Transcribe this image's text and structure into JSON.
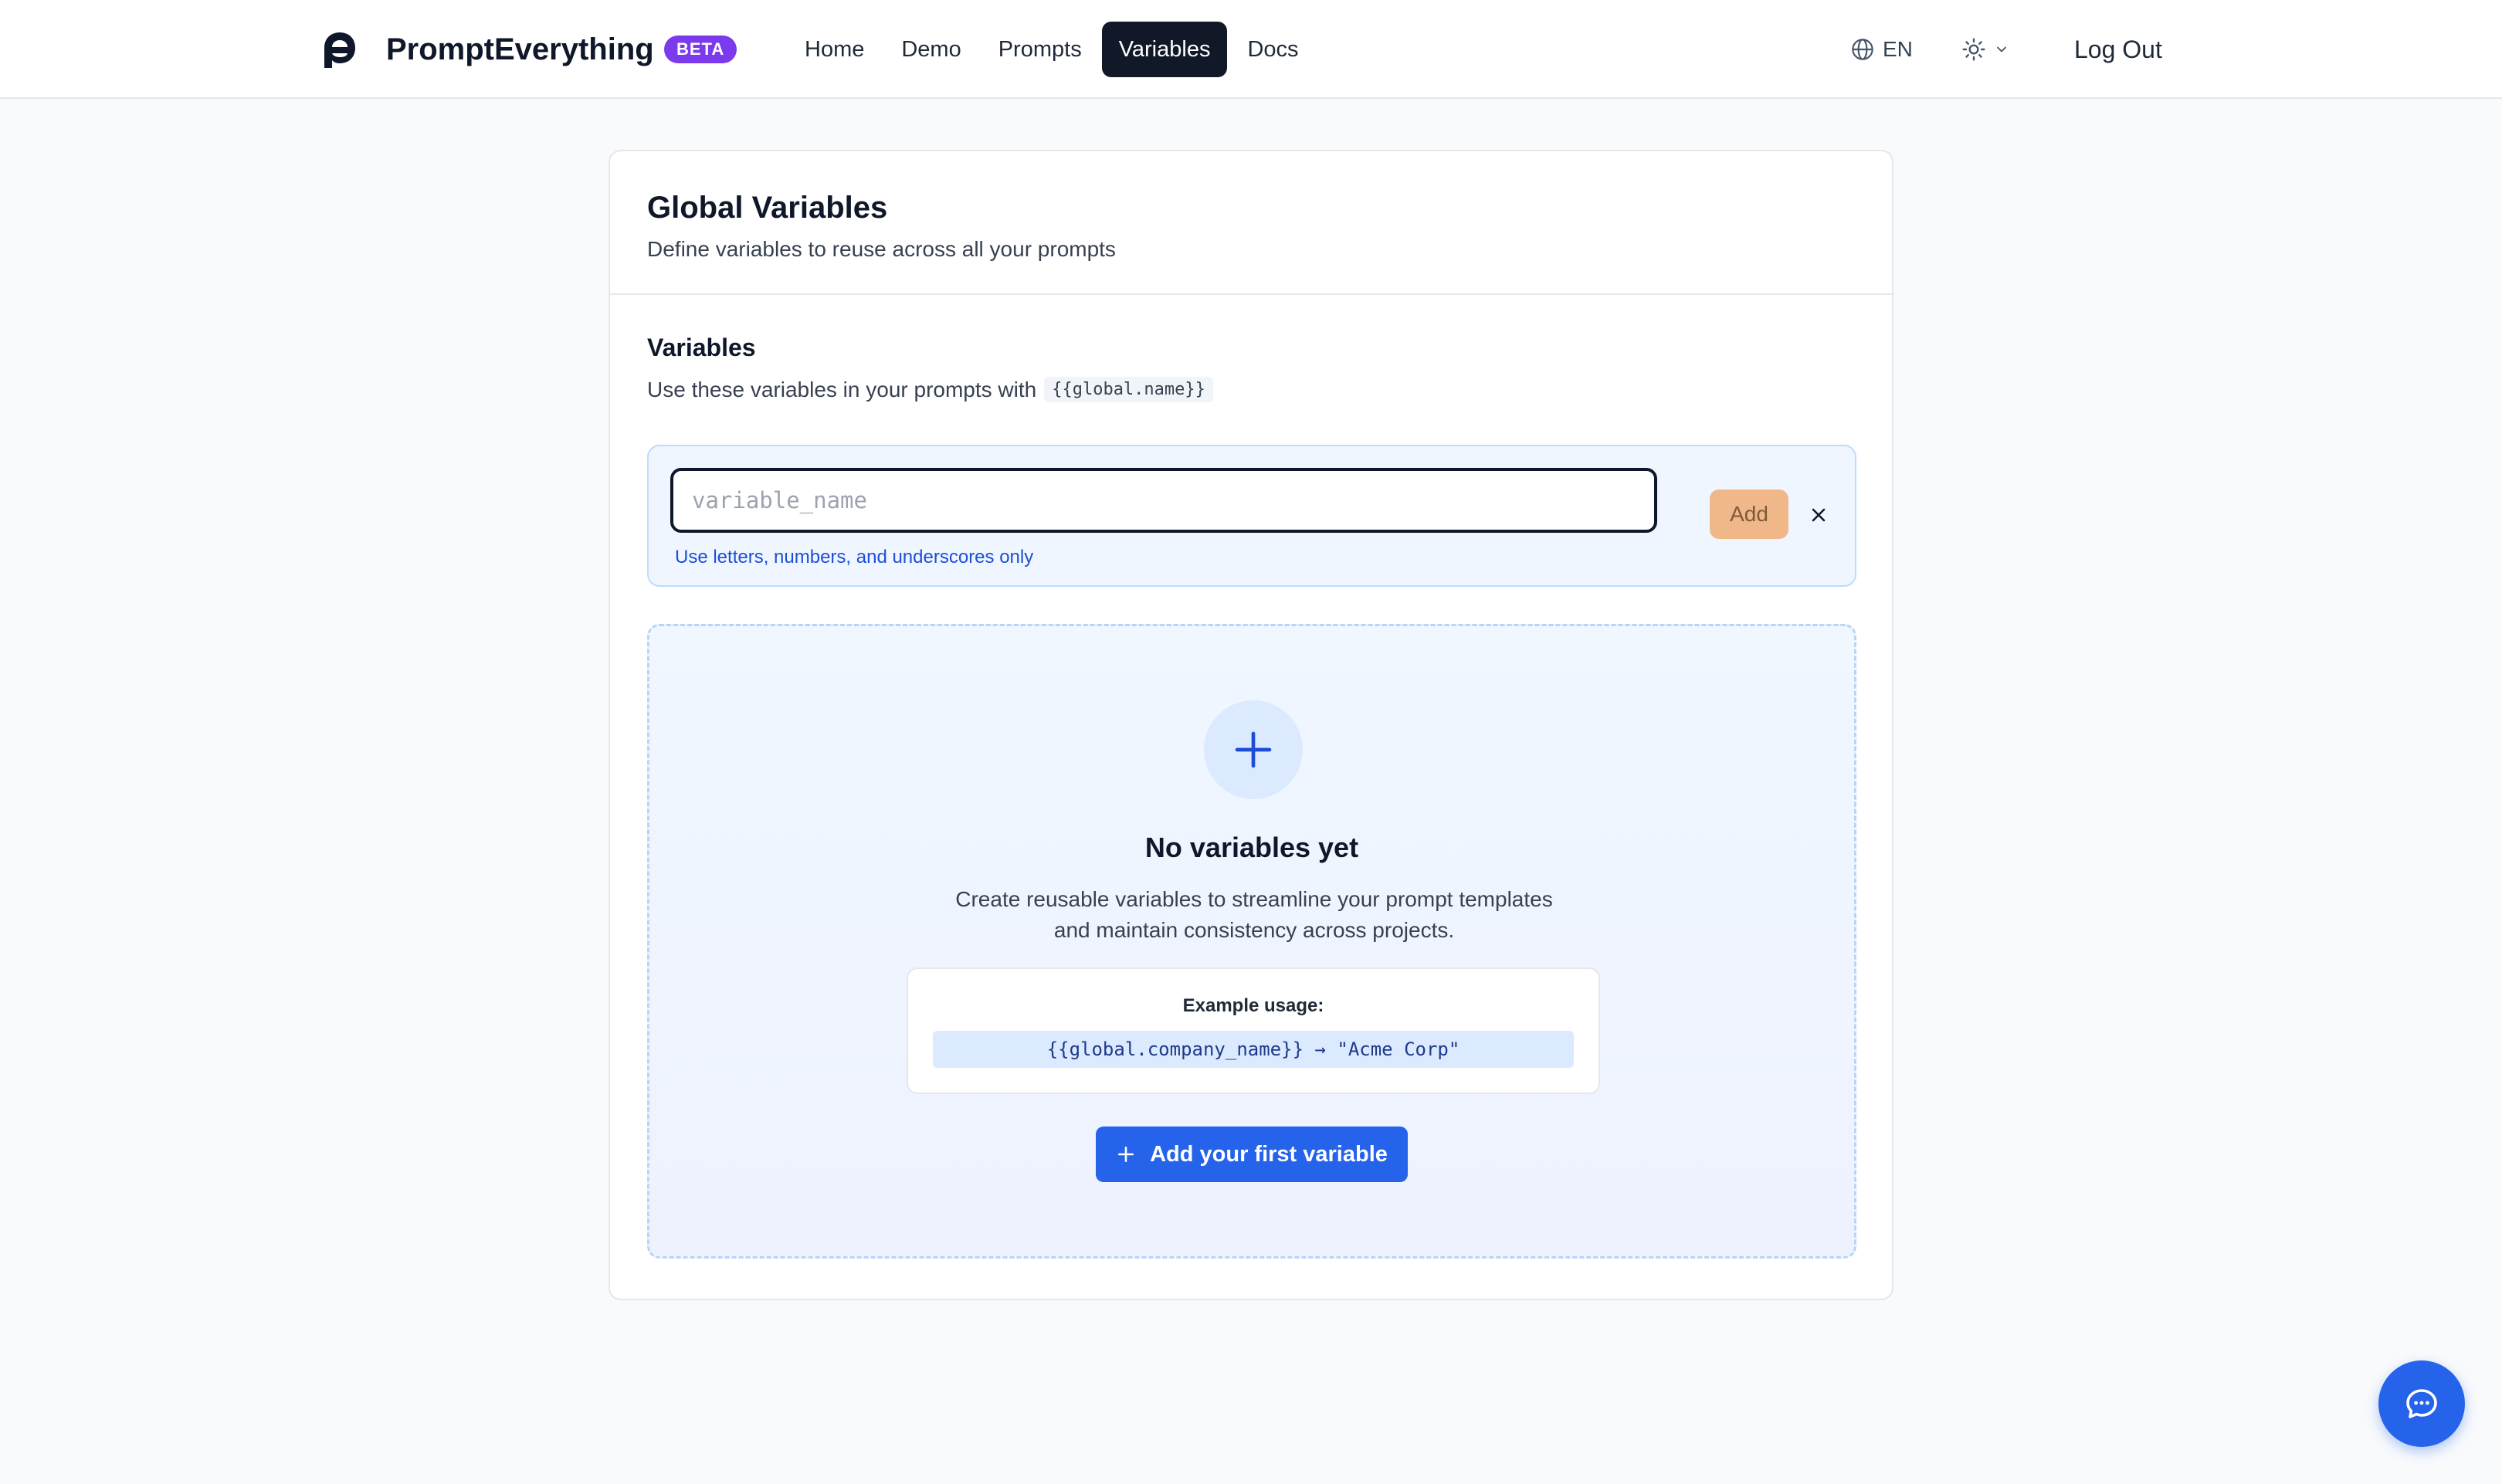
{
  "header": {
    "brand": "PromptEverything",
    "badge": "BETA",
    "nav": [
      "Home",
      "Demo",
      "Prompts",
      "Variables",
      "Docs"
    ],
    "active_nav": "Variables",
    "language": "EN",
    "logout_label": "Log Out",
    "icons": {
      "logo": "logo-icon",
      "language": "globe-icon",
      "theme": "sun-icon",
      "theme_caret": "chevron-down-icon"
    }
  },
  "card": {
    "title": "Global Variables",
    "subtitle": "Define variables to reuse across all your prompts"
  },
  "variables_section": {
    "title": "Variables",
    "usage_prefix": "Use these variables in your prompts with",
    "usage_code": "{{global.name}}"
  },
  "add_form": {
    "input_value": "",
    "input_placeholder": "variable_name",
    "hint": "Use letters, numbers, and underscores only",
    "add_label": "Add",
    "close_icon": "close-icon"
  },
  "empty_state": {
    "title": "No variables yet",
    "description": "Create reusable variables to streamline your prompt templates and maintain consistency across projects.",
    "example_label": "Example usage:",
    "example_code": "{{global.company_name}} → \"Acme Corp\"",
    "cta_label": "Add your first variable"
  },
  "colors": {
    "primary": "#2563eb",
    "beta": "#7c3aed",
    "active_nav_bg": "#111827",
    "add_button_disabled": "#f0b788"
  }
}
